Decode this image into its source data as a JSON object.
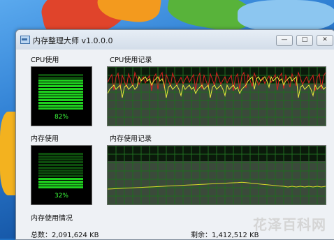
{
  "window": {
    "title": "内存整理大师 v1.0.0.0",
    "buttons": {
      "minimize": "—",
      "maximize": "□",
      "close": "✕"
    }
  },
  "cpu": {
    "usage_label": "CPU使用",
    "history_label": "CPU使用记录",
    "usage_percent_text": "82%",
    "usage_value": 82
  },
  "memory": {
    "usage_label": "内存使用",
    "history_label": "内存使用记录",
    "usage_percent_text": "32%",
    "usage_value": 32
  },
  "memory_info": {
    "section_label": "内存使用情况",
    "total_text": "总数：2,091,624 KB",
    "free_text": "剩余：1,412,512 KB"
  },
  "watermark": "花泽百科网",
  "colors": {
    "gauge_lit": "#1fd11f",
    "gauge_dim": "#0d4d0d",
    "cpu_line_yellow": "#e8e83a",
    "cpu_line_red": "#d82020",
    "mem_line_yellow": "#d8d82a",
    "grid_green": "#1f6b1f"
  }
}
